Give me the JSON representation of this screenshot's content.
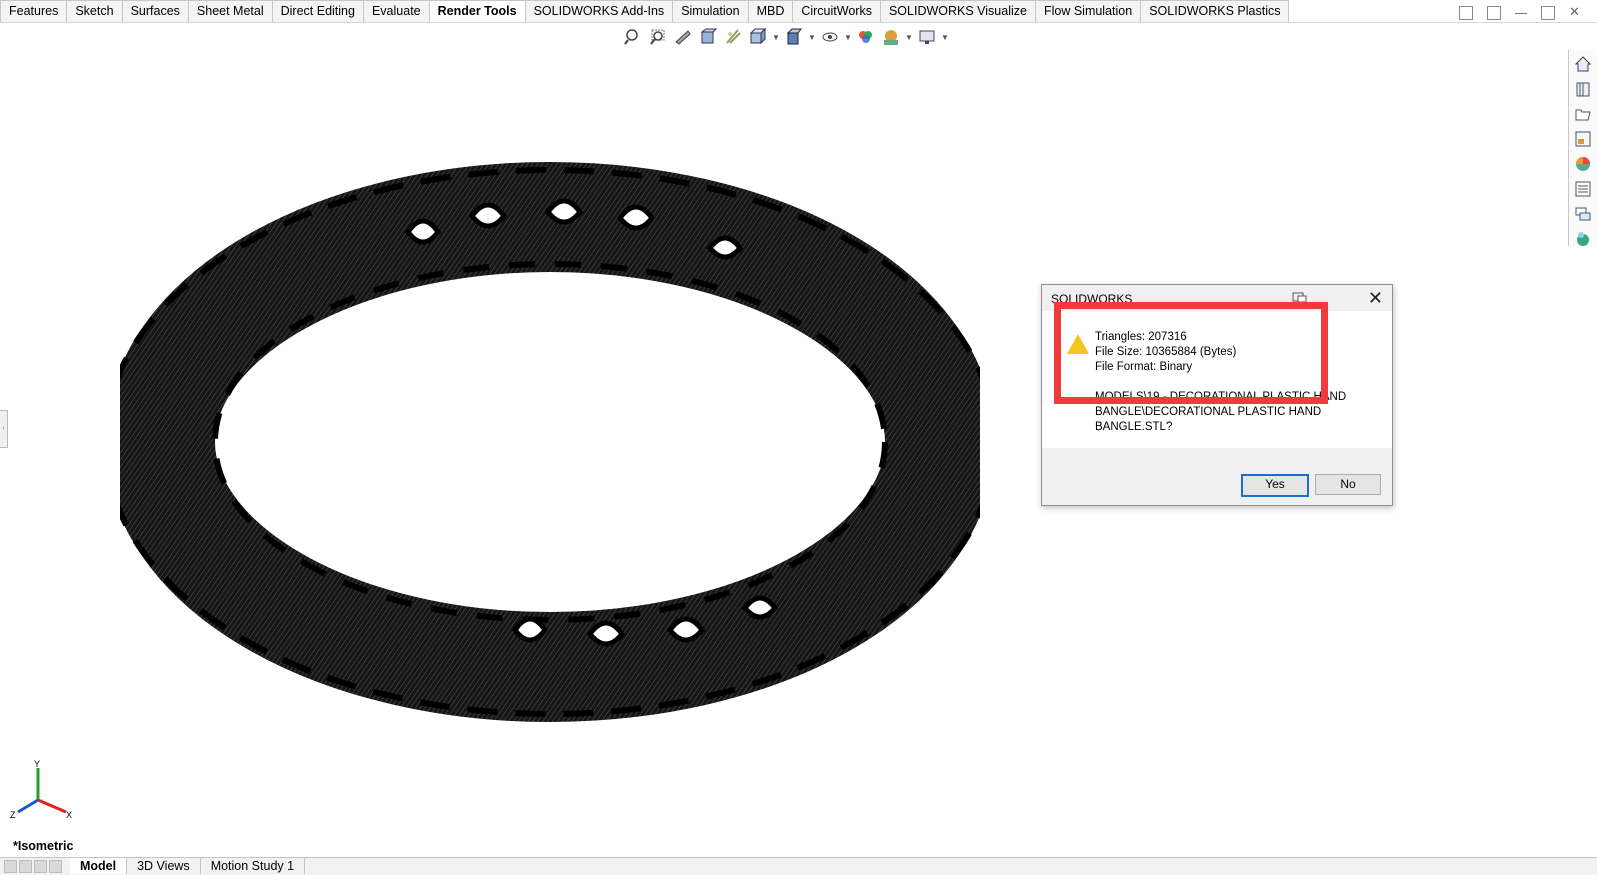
{
  "ribbon": {
    "tabs": [
      {
        "label": "Features"
      },
      {
        "label": "Sketch"
      },
      {
        "label": "Surfaces"
      },
      {
        "label": "Sheet Metal"
      },
      {
        "label": "Direct Editing"
      },
      {
        "label": "Evaluate"
      },
      {
        "label": "Render Tools",
        "active": true
      },
      {
        "label": "SOLIDWORKS Add-Ins"
      },
      {
        "label": "Simulation"
      },
      {
        "label": "MBD"
      },
      {
        "label": "CircuitWorks"
      },
      {
        "label": "SOLIDWORKS Visualize"
      },
      {
        "label": "Flow Simulation"
      },
      {
        "label": "SOLIDWORKS Plastics"
      }
    ]
  },
  "heads_up_toolbar": {
    "icons": [
      "zoom-to-fit-icon",
      "zoom-to-area-icon",
      "previous-view-icon",
      "section-view-icon",
      "dynamic-annotation-icon",
      "view-orientation-icon",
      "display-style-icon",
      "hide-show-items-icon",
      "edit-appearance-icon",
      "apply-scene-icon",
      "view-settings-icon"
    ]
  },
  "task_pane": {
    "icons": [
      "home-icon",
      "resources-icon",
      "design-library-icon",
      "file-explorer-icon",
      "appearances-icon",
      "custom-properties-icon",
      "forum-icon",
      "3d-experience-icon"
    ]
  },
  "viewport": {
    "view_name": "*Isometric",
    "triad_axes": [
      "Y",
      "Z",
      "X"
    ]
  },
  "bottom_tabs": [
    {
      "label": "Model",
      "active": true
    },
    {
      "label": "3D Views"
    },
    {
      "label": "Motion Study 1"
    }
  ],
  "dialog": {
    "title": "SOLIDWORKS",
    "triangles": "Triangles: 207316",
    "file_size": "File Size: 10365884 (Bytes)",
    "file_format": "File Format: Binary",
    "question_line1": "MODELS\\19 - DECORATIONAL PLASTIC HAND",
    "question_line2": "BANGLE\\DECORATIONAL PLASTIC HAND",
    "question_line3": "BANGLE.STL?",
    "yes_label": "Yes",
    "no_label": "No",
    "highlight_color": "#ef3b3b"
  }
}
